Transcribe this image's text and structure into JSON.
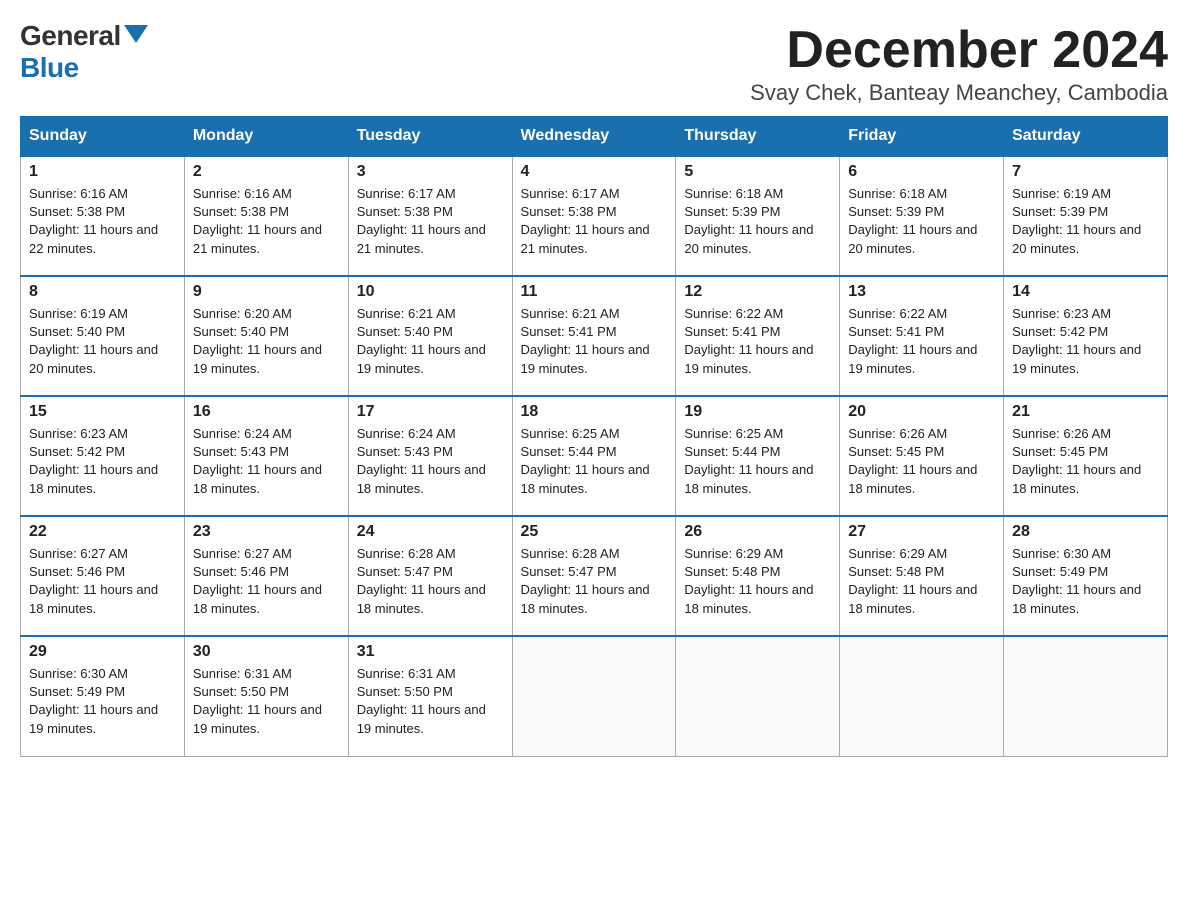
{
  "logo": {
    "general": "General",
    "blue": "Blue"
  },
  "title": "December 2024",
  "subtitle": "Svay Chek, Banteay Meanchey, Cambodia",
  "headers": [
    "Sunday",
    "Monday",
    "Tuesday",
    "Wednesday",
    "Thursday",
    "Friday",
    "Saturday"
  ],
  "weeks": [
    [
      {
        "day": "1",
        "sunrise": "6:16 AM",
        "sunset": "5:38 PM",
        "daylight": "11 hours and 22 minutes."
      },
      {
        "day": "2",
        "sunrise": "6:16 AM",
        "sunset": "5:38 PM",
        "daylight": "11 hours and 21 minutes."
      },
      {
        "day": "3",
        "sunrise": "6:17 AM",
        "sunset": "5:38 PM",
        "daylight": "11 hours and 21 minutes."
      },
      {
        "day": "4",
        "sunrise": "6:17 AM",
        "sunset": "5:38 PM",
        "daylight": "11 hours and 21 minutes."
      },
      {
        "day": "5",
        "sunrise": "6:18 AM",
        "sunset": "5:39 PM",
        "daylight": "11 hours and 20 minutes."
      },
      {
        "day": "6",
        "sunrise": "6:18 AM",
        "sunset": "5:39 PM",
        "daylight": "11 hours and 20 minutes."
      },
      {
        "day": "7",
        "sunrise": "6:19 AM",
        "sunset": "5:39 PM",
        "daylight": "11 hours and 20 minutes."
      }
    ],
    [
      {
        "day": "8",
        "sunrise": "6:19 AM",
        "sunset": "5:40 PM",
        "daylight": "11 hours and 20 minutes."
      },
      {
        "day": "9",
        "sunrise": "6:20 AM",
        "sunset": "5:40 PM",
        "daylight": "11 hours and 19 minutes."
      },
      {
        "day": "10",
        "sunrise": "6:21 AM",
        "sunset": "5:40 PM",
        "daylight": "11 hours and 19 minutes."
      },
      {
        "day": "11",
        "sunrise": "6:21 AM",
        "sunset": "5:41 PM",
        "daylight": "11 hours and 19 minutes."
      },
      {
        "day": "12",
        "sunrise": "6:22 AM",
        "sunset": "5:41 PM",
        "daylight": "11 hours and 19 minutes."
      },
      {
        "day": "13",
        "sunrise": "6:22 AM",
        "sunset": "5:41 PM",
        "daylight": "11 hours and 19 minutes."
      },
      {
        "day": "14",
        "sunrise": "6:23 AM",
        "sunset": "5:42 PM",
        "daylight": "11 hours and 19 minutes."
      }
    ],
    [
      {
        "day": "15",
        "sunrise": "6:23 AM",
        "sunset": "5:42 PM",
        "daylight": "11 hours and 18 minutes."
      },
      {
        "day": "16",
        "sunrise": "6:24 AM",
        "sunset": "5:43 PM",
        "daylight": "11 hours and 18 minutes."
      },
      {
        "day": "17",
        "sunrise": "6:24 AM",
        "sunset": "5:43 PM",
        "daylight": "11 hours and 18 minutes."
      },
      {
        "day": "18",
        "sunrise": "6:25 AM",
        "sunset": "5:44 PM",
        "daylight": "11 hours and 18 minutes."
      },
      {
        "day": "19",
        "sunrise": "6:25 AM",
        "sunset": "5:44 PM",
        "daylight": "11 hours and 18 minutes."
      },
      {
        "day": "20",
        "sunrise": "6:26 AM",
        "sunset": "5:45 PM",
        "daylight": "11 hours and 18 minutes."
      },
      {
        "day": "21",
        "sunrise": "6:26 AM",
        "sunset": "5:45 PM",
        "daylight": "11 hours and 18 minutes."
      }
    ],
    [
      {
        "day": "22",
        "sunrise": "6:27 AM",
        "sunset": "5:46 PM",
        "daylight": "11 hours and 18 minutes."
      },
      {
        "day": "23",
        "sunrise": "6:27 AM",
        "sunset": "5:46 PM",
        "daylight": "11 hours and 18 minutes."
      },
      {
        "day": "24",
        "sunrise": "6:28 AM",
        "sunset": "5:47 PM",
        "daylight": "11 hours and 18 minutes."
      },
      {
        "day": "25",
        "sunrise": "6:28 AM",
        "sunset": "5:47 PM",
        "daylight": "11 hours and 18 minutes."
      },
      {
        "day": "26",
        "sunrise": "6:29 AM",
        "sunset": "5:48 PM",
        "daylight": "11 hours and 18 minutes."
      },
      {
        "day": "27",
        "sunrise": "6:29 AM",
        "sunset": "5:48 PM",
        "daylight": "11 hours and 18 minutes."
      },
      {
        "day": "28",
        "sunrise": "6:30 AM",
        "sunset": "5:49 PM",
        "daylight": "11 hours and 18 minutes."
      }
    ],
    [
      {
        "day": "29",
        "sunrise": "6:30 AM",
        "sunset": "5:49 PM",
        "daylight": "11 hours and 19 minutes."
      },
      {
        "day": "30",
        "sunrise": "6:31 AM",
        "sunset": "5:50 PM",
        "daylight": "11 hours and 19 minutes."
      },
      {
        "day": "31",
        "sunrise": "6:31 AM",
        "sunset": "5:50 PM",
        "daylight": "11 hours and 19 minutes."
      },
      null,
      null,
      null,
      null
    ]
  ]
}
